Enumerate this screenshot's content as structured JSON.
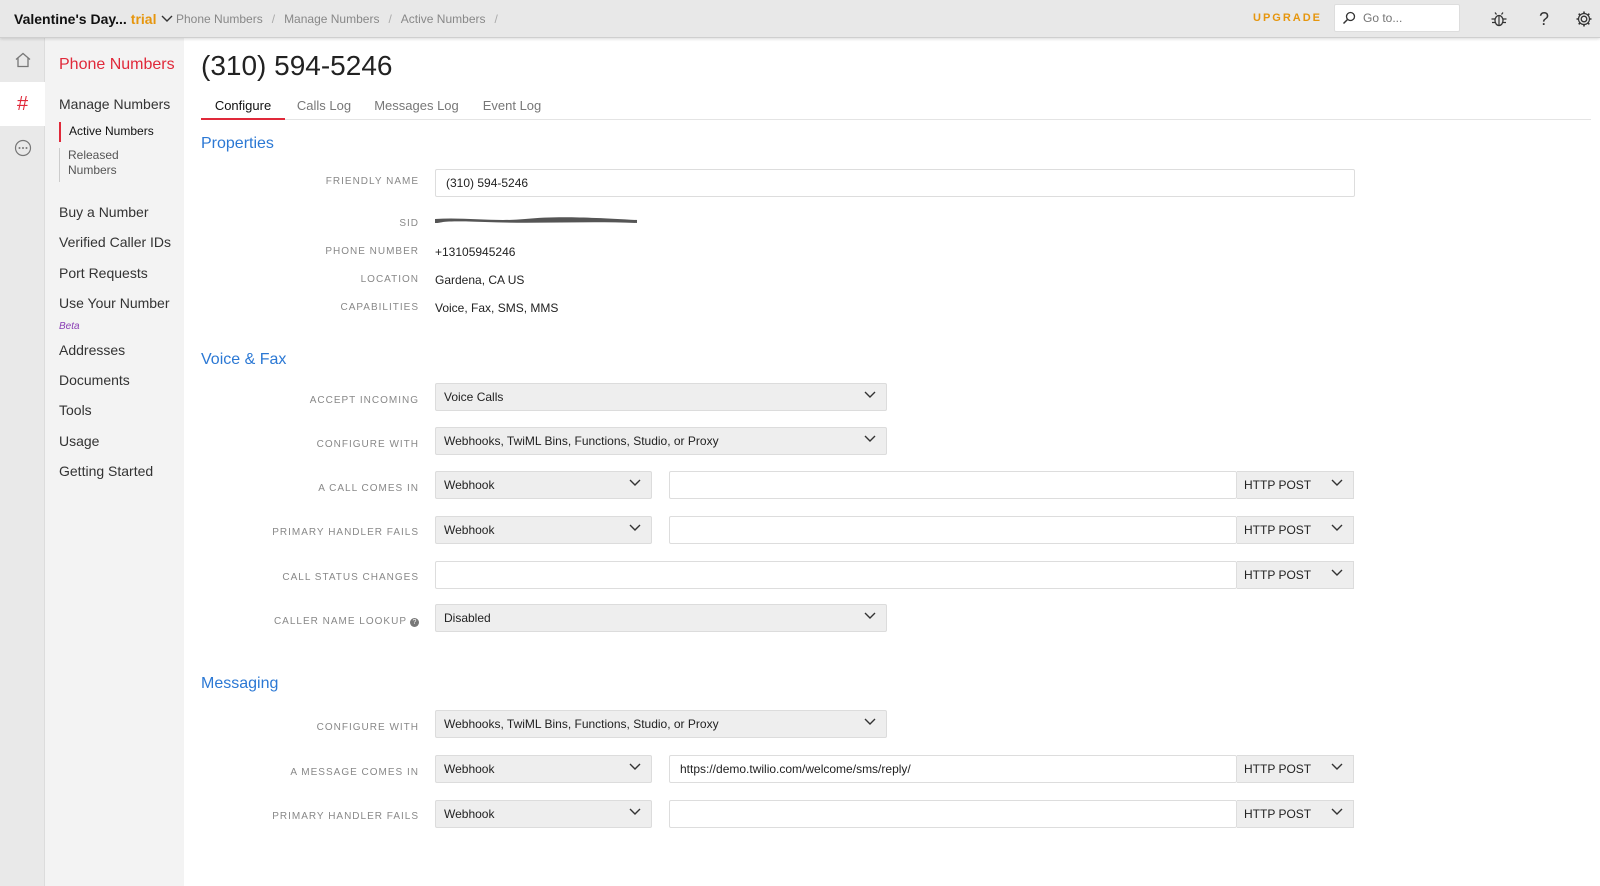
{
  "topbar": {
    "account_name": "Valentine's Day...",
    "account_status": "trial",
    "breadcrumbs": [
      "Phone Numbers",
      "Manage Numbers",
      "Active Numbers"
    ],
    "upgrade_label": "UPGRADE",
    "search_placeholder": "Go to..."
  },
  "rail": {
    "items": [
      "home-icon",
      "hash-icon",
      "more-icon"
    ],
    "accent_color": "#e0293a"
  },
  "sidebar": {
    "title": "Phone Numbers",
    "manage_numbers": "Manage Numbers",
    "sub_items": [
      "Active Numbers",
      "Released Numbers"
    ],
    "items": [
      "Buy a Number",
      "Verified Caller IDs",
      "Port Requests",
      "Use Your Number",
      "Addresses",
      "Documents",
      "Tools",
      "Usage",
      "Getting Started"
    ],
    "beta_badge": "Beta"
  },
  "page": {
    "title": "(310) 594-5246",
    "tabs": [
      "Configure",
      "Calls Log",
      "Messages Log",
      "Event Log"
    ]
  },
  "properties": {
    "section_title": "Properties",
    "friendly_name_label": "FRIENDLY NAME",
    "friendly_name_value": "(310) 594-5246",
    "sid_label": "SID",
    "phone_number_label": "PHONE NUMBER",
    "phone_number_value": "+13105945246",
    "location_label": "LOCATION",
    "location_value": "Gardena, CA US",
    "capabilities_label": "CAPABILITIES",
    "capabilities_value": "Voice, Fax, SMS, MMS"
  },
  "voice": {
    "section_title": "Voice & Fax",
    "accept_incoming_label": "ACCEPT INCOMING",
    "accept_incoming_value": "Voice Calls",
    "configure_with_label": "CONFIGURE WITH",
    "configure_with_value": "Webhooks, TwiML Bins, Functions, Studio, or Proxy",
    "call_comes_in_label": "A CALL COMES IN",
    "call_comes_in_type": "Webhook",
    "call_comes_in_url": "",
    "call_comes_in_method": "HTTP POST",
    "primary_fails_label": "PRIMARY HANDLER FAILS",
    "primary_fails_type": "Webhook",
    "primary_fails_url": "",
    "primary_fails_method": "HTTP POST",
    "status_changes_label": "CALL STATUS CHANGES",
    "status_changes_url": "",
    "status_changes_method": "HTTP POST",
    "caller_lookup_label": "CALLER NAME LOOKUP",
    "caller_lookup_value": "Disabled"
  },
  "messaging": {
    "section_title": "Messaging",
    "configure_with_label": "CONFIGURE WITH",
    "configure_with_value": "Webhooks, TwiML Bins, Functions, Studio, or Proxy",
    "message_comes_in_label": "A MESSAGE COMES IN",
    "message_comes_in_type": "Webhook",
    "message_comes_in_url": "https://demo.twilio.com/welcome/sms/reply/",
    "message_comes_in_method": "HTTP POST",
    "primary_fails_label": "PRIMARY HANDLER FAILS",
    "primary_fails_type": "Webhook",
    "primary_fails_url": "",
    "primary_fails_method": "HTTP POST"
  }
}
